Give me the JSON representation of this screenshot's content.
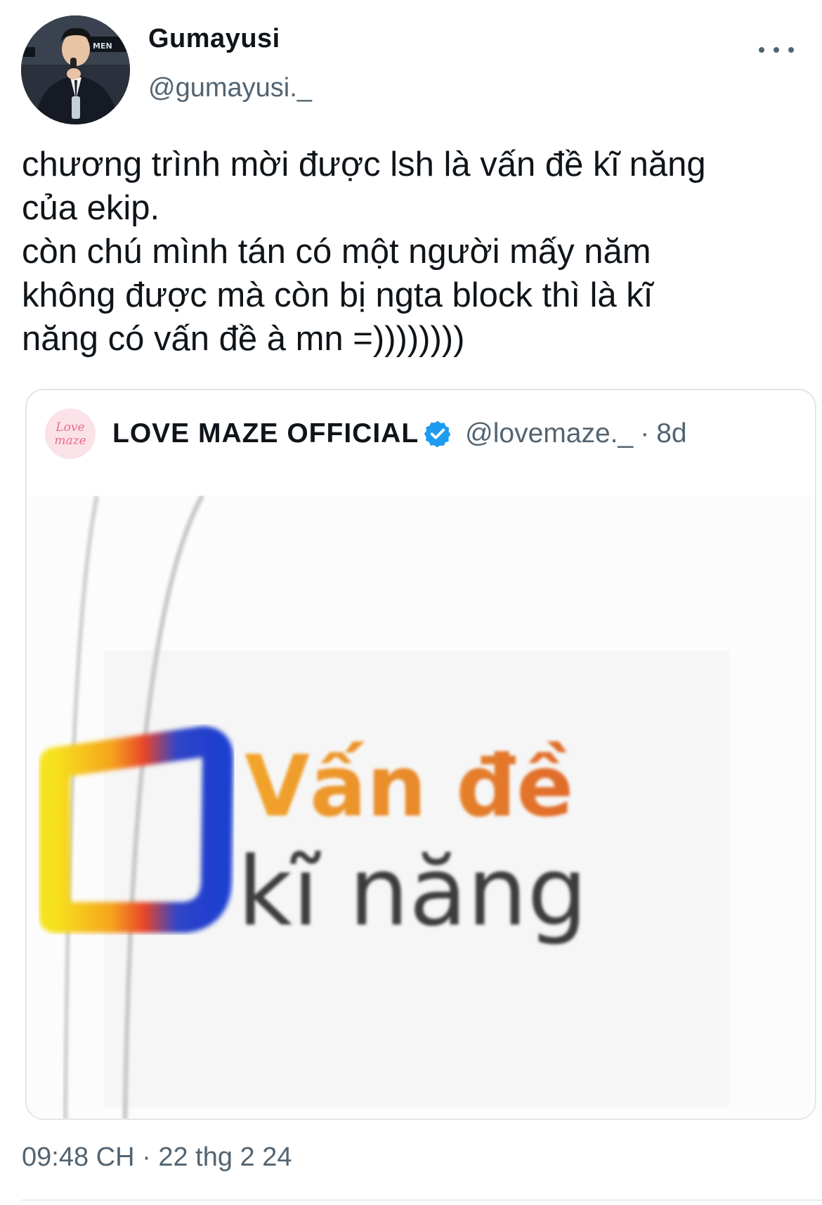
{
  "tweet": {
    "author_name": "Gumayusi",
    "author_handle": "@gumayusi._",
    "text": "chương trình mời được lsh là vấn đề kĩ năng\ncủa ekip.\ncòn chú mình tán có một người mấy năm\nkhông được mà còn bị ngta block thì là kĩ\nnăng có vấn đề à mn =))))))))",
    "timestamp": "09:48 CH",
    "separator": "·",
    "date": "22 thg 2 24"
  },
  "quote": {
    "author_name": "LOVE MAZE OFFICIAL",
    "author_handle": "@lovemaze._",
    "separator": "·",
    "age": "8d",
    "avatar_text_line1": "Love",
    "avatar_text_line2": "maze",
    "image_text_line1": "Vấn đề",
    "image_text_line2": "kĩ năng"
  },
  "icons": {
    "more": "more-horizontal-icon",
    "verified": "verified-badge-icon"
  },
  "colors": {
    "text": "#0f1419",
    "secondary": "#536471",
    "verified": "#1d9bf0",
    "border": "#e1e6ea"
  }
}
